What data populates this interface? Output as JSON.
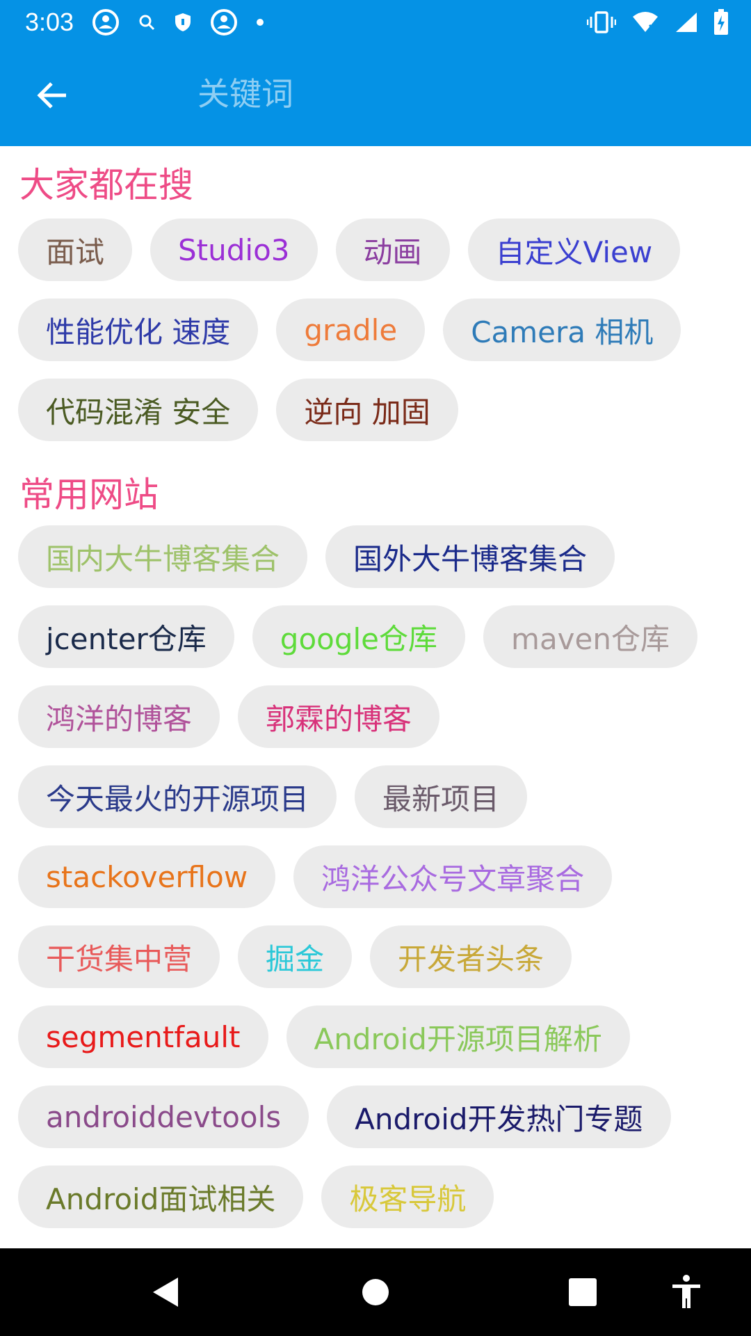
{
  "status": {
    "time": "3:03",
    "left_icons": [
      "avatar-icon",
      "search-icon",
      "shield-icon",
      "avatar-icon",
      "dot-icon"
    ],
    "right_icons": [
      "vibrate-icon",
      "wifi-icon",
      "signal-icon",
      "battery-icon"
    ]
  },
  "appbar": {
    "search_placeholder": "关键词"
  },
  "sections": [
    {
      "title": "大家都在搜",
      "tags": [
        {
          "label": "面试",
          "color": "#7a5c4c"
        },
        {
          "label": "Studio3",
          "color": "#9b2fd6"
        },
        {
          "label": "动画",
          "color": "#8b3ea0"
        },
        {
          "label": "自定义View",
          "color": "#3a3fd0"
        },
        {
          "label": "性能优化 速度",
          "color": "#2e3aa8"
        },
        {
          "label": "gradle",
          "color": "#ee7b3a"
        },
        {
          "label": "Camera 相机",
          "color": "#2e7bb8"
        },
        {
          "label": "代码混淆 安全",
          "color": "#4a5a22"
        },
        {
          "label": "逆向 加固",
          "color": "#7a2a18"
        }
      ]
    },
    {
      "title": "常用网站",
      "tags": [
        {
          "label": "国内大牛博客集合",
          "color": "#9ec26a"
        },
        {
          "label": "国外大牛博客集合",
          "color": "#1a2a8a"
        },
        {
          "label": "jcenter仓库",
          "color": "#1a2a4a"
        },
        {
          "label": "google仓库",
          "color": "#5edb3a"
        },
        {
          "label": "maven仓库",
          "color": "#a89a9a"
        },
        {
          "label": "鸿洋的博客",
          "color": "#b0529a"
        },
        {
          "label": "郭霖的博客",
          "color": "#d8327a"
        },
        {
          "label": "今天最火的开源项目",
          "color": "#2a3a8a"
        },
        {
          "label": "最新项目",
          "color": "#6a5a6a"
        },
        {
          "label": "stackoverflow",
          "color": "#e8741a"
        },
        {
          "label": "鸿洋公众号文章聚合",
          "color": "#a86ae0"
        },
        {
          "label": "干货集中营",
          "color": "#e85a5a"
        },
        {
          "label": "掘金",
          "color": "#2ac8d8"
        },
        {
          "label": "开发者头条",
          "color": "#c8a838"
        },
        {
          "label": "segmentfault",
          "color": "#e81a1a"
        },
        {
          "label": "Android开源项目解析",
          "color": "#8ac85a"
        },
        {
          "label": "androiddevtools",
          "color": "#8a4a8a"
        },
        {
          "label": "Android开发热门专题",
          "color": "#1a1a6a"
        },
        {
          "label": "Android面试相关",
          "color": "#6a7a2a"
        },
        {
          "label": "极客导航",
          "color": "#d8c83a"
        }
      ]
    }
  ],
  "navbar": {
    "buttons": [
      "back-triangle-icon",
      "home-circle-icon",
      "recents-square-icon",
      "accessibility-icon"
    ]
  }
}
